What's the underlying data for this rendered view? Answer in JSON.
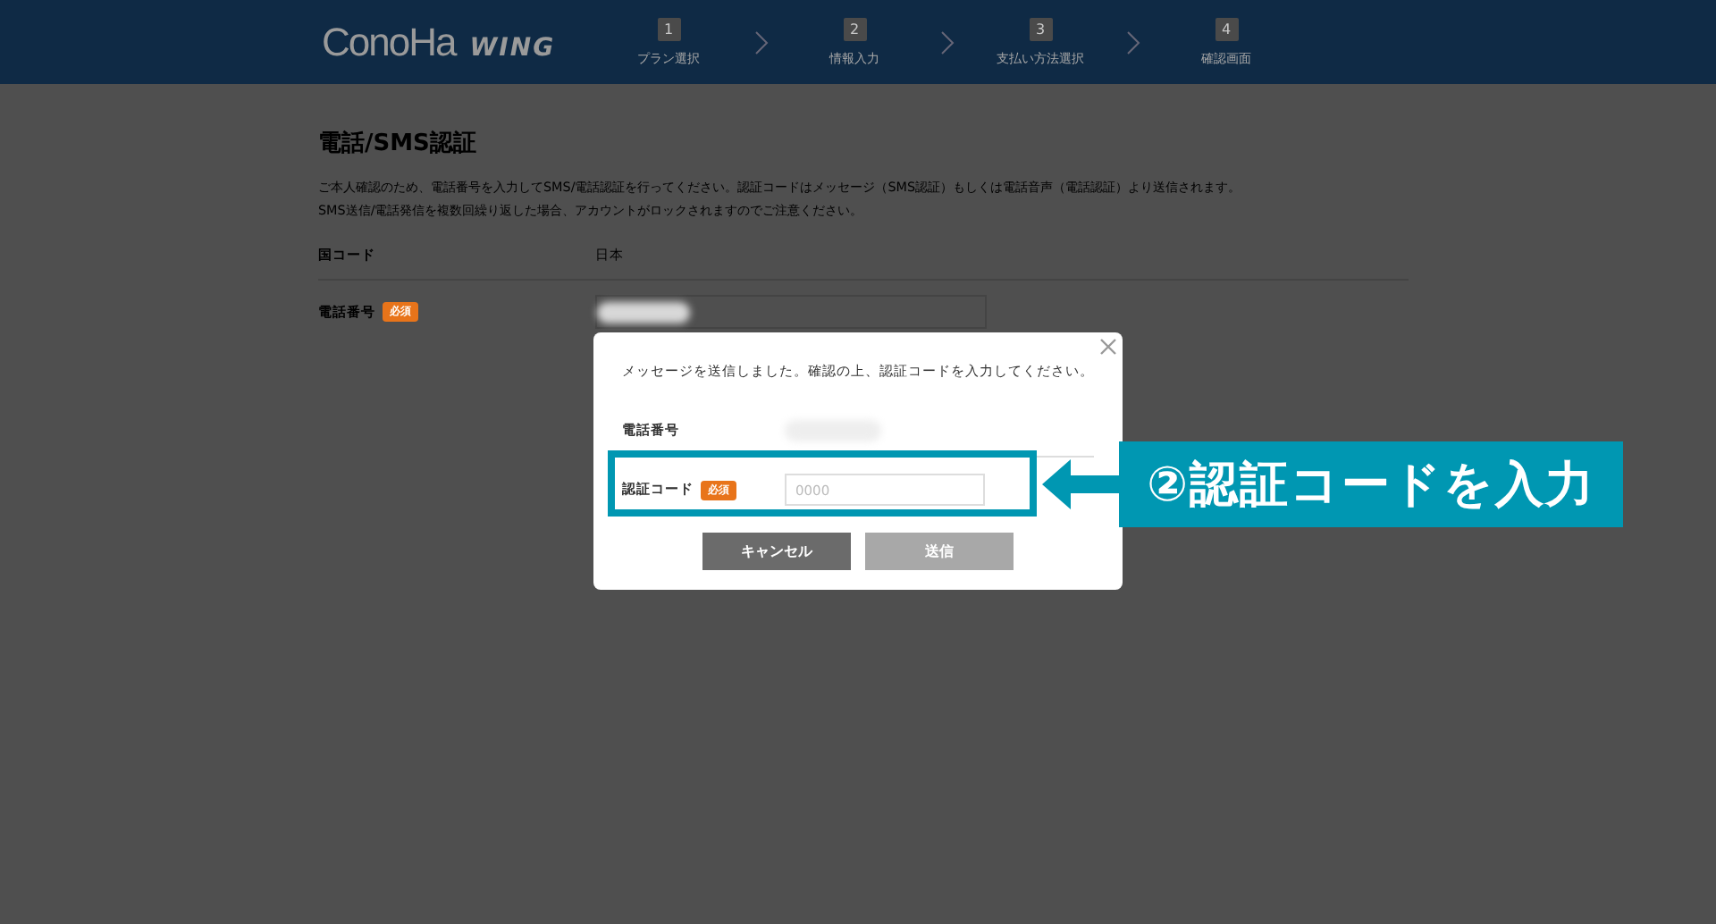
{
  "header": {
    "logo": "ConoHa",
    "logo_sub": "WING",
    "steps": [
      {
        "number": "1",
        "label": "プラン選択"
      },
      {
        "number": "2",
        "label": "情報入力"
      },
      {
        "number": "3",
        "label": "支払い方法選択"
      },
      {
        "number": "4",
        "label": "確認画面"
      }
    ]
  },
  "page": {
    "title": "電話/SMS認証",
    "description": [
      "ご本人確認のため、電話番号を入力してSMS/電話認証を行ってください。認証コードはメッセージ（SMS認証）もしくは電話音声（電話認証）より送信されます。",
      "SMS送信/電話発信を複数回繰り返した場合、アカウントがロックされますのでご注意ください。"
    ],
    "rows": [
      {
        "kind": "text",
        "label": "国コード",
        "value": "日本"
      },
      {
        "kind": "input",
        "label": "電話番号",
        "badge": "必須"
      }
    ]
  },
  "modal": {
    "message": "メッセージを送信しました。確認の上、認証コードを入力してください。",
    "rows": [
      {
        "kind": "text",
        "label": "電話番号"
      },
      {
        "kind": "input",
        "label": "認証コード",
        "badge": "必須",
        "placeholder": "0000"
      }
    ],
    "buttons": [
      {
        "label": "キャンセル",
        "disabled": false
      },
      {
        "label": "送信",
        "disabled": true
      }
    ]
  },
  "annotation": {
    "label": "②認証コードを入力"
  }
}
